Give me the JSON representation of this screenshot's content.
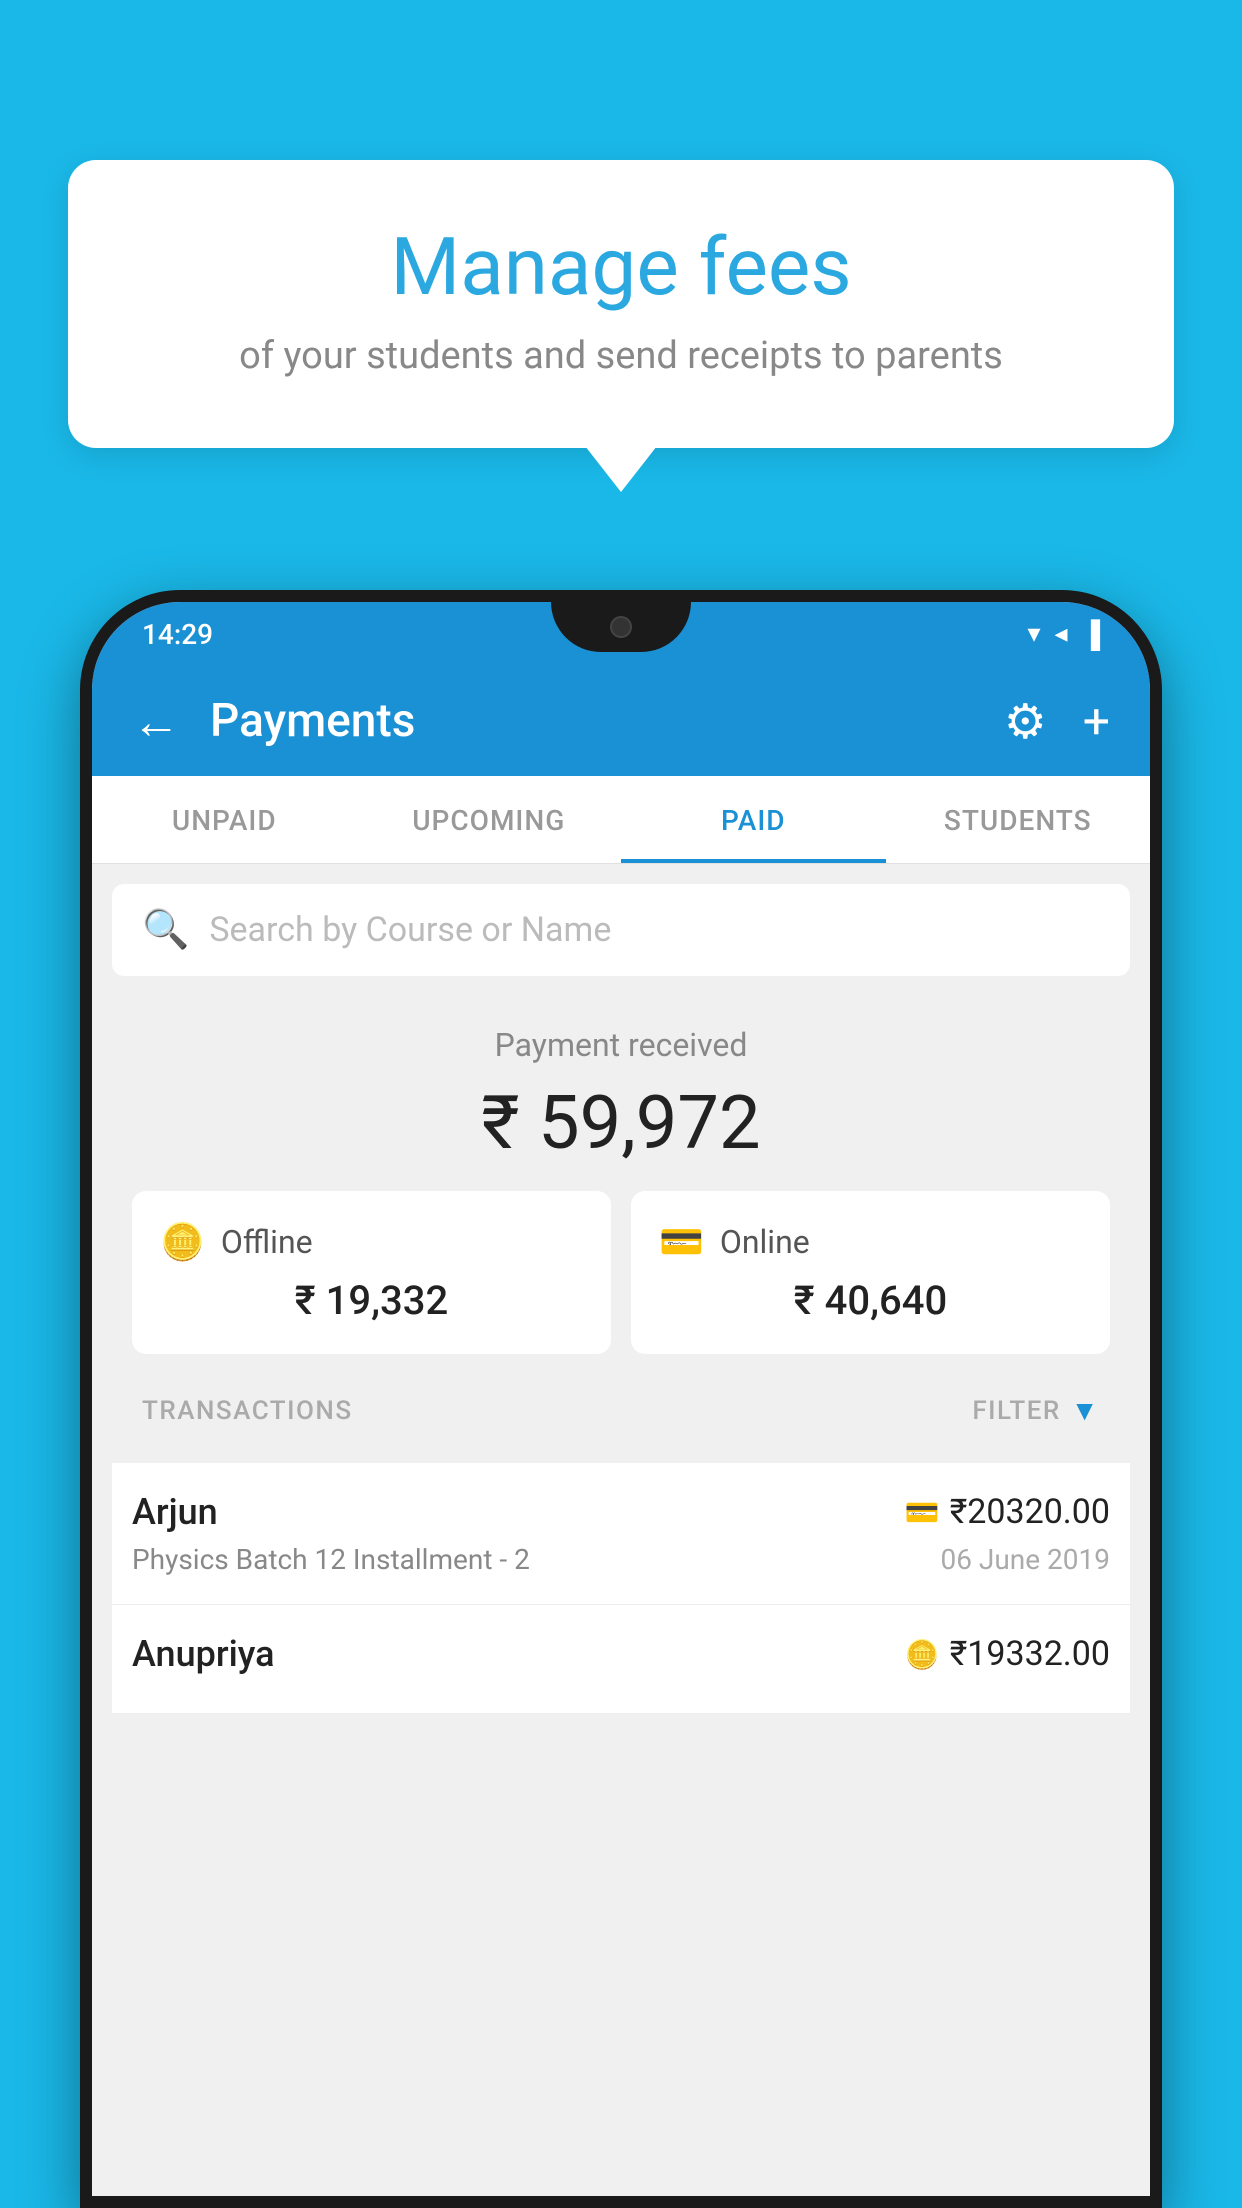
{
  "background_color": "#1ab8e8",
  "speech_bubble": {
    "title": "Manage fees",
    "subtitle": "of your students and send receipts to parents"
  },
  "phone": {
    "status_bar": {
      "time": "14:29",
      "wifi": "▼",
      "signal": "▲",
      "battery": "▐"
    },
    "app_bar": {
      "title": "Payments",
      "back_label": "←",
      "gear_label": "⚙",
      "plus_label": "+"
    },
    "tabs": [
      {
        "label": "UNPAID",
        "active": false
      },
      {
        "label": "UPCOMING",
        "active": false
      },
      {
        "label": "PAID",
        "active": true
      },
      {
        "label": "STUDENTS",
        "active": false
      }
    ],
    "search": {
      "placeholder": "Search by Course or Name"
    },
    "payment_received": {
      "label": "Payment received",
      "amount": "₹ 59,972"
    },
    "payment_cards": [
      {
        "type": "Offline",
        "amount": "₹ 19,332",
        "icon": "offline"
      },
      {
        "type": "Online",
        "amount": "₹ 40,640",
        "icon": "online"
      }
    ],
    "transactions_section": {
      "label": "TRANSACTIONS",
      "filter_label": "FILTER"
    },
    "transactions": [
      {
        "name": "Arjun",
        "course": "Physics Batch 12 Installment - 2",
        "amount": "₹20320.00",
        "date": "06 June 2019",
        "payment_type": "online"
      },
      {
        "name": "Anupriya",
        "course": "",
        "amount": "₹19332.00",
        "date": "",
        "payment_type": "offline"
      }
    ]
  }
}
